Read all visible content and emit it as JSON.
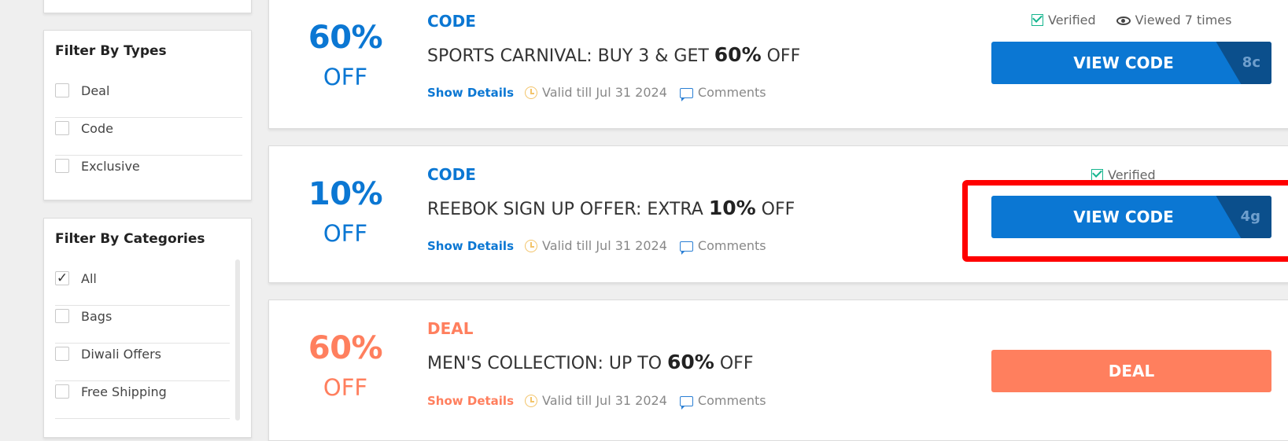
{
  "sidebar": {
    "types_title": "Filter By Types",
    "types": [
      {
        "label": "Deal",
        "checked": false
      },
      {
        "label": "Code",
        "checked": false
      },
      {
        "label": "Exclusive",
        "checked": false
      }
    ],
    "categories_title": "Filter By Categories",
    "categories": [
      {
        "label": "All",
        "checked": true,
        "check_glyph": "✓"
      },
      {
        "label": "Bags",
        "checked": false
      },
      {
        "label": "Diwali Offers",
        "checked": false
      },
      {
        "label": "Free Shipping",
        "checked": false
      }
    ]
  },
  "offers": [
    {
      "percent": "60%",
      "off": "OFF",
      "type": "CODE",
      "title_pre": "SPORTS CARNIVAL: BUY 3 & GET ",
      "title_bold": "60%",
      "title_post": " OFF",
      "show_details": "Show Details",
      "valid": "Valid till Jul 31 2024",
      "comments": "Comments",
      "verified": "Verified",
      "viewed": "Viewed 7 times",
      "button": "VIEW CODE",
      "code_peek": "8c"
    },
    {
      "percent": "10%",
      "off": "OFF",
      "type": "CODE",
      "title_pre": "REEBOK SIGN UP OFFER: EXTRA ",
      "title_bold": "10%",
      "title_post": " OFF",
      "show_details": "Show Details",
      "valid": "Valid till Jul 31 2024",
      "comments": "Comments",
      "verified": "Verified",
      "button": "VIEW CODE",
      "code_peek": "4g"
    },
    {
      "percent": "60%",
      "off": "OFF",
      "type": "DEAL",
      "title_pre": "MEN'S COLLECTION: UP TO ",
      "title_bold": "60%",
      "title_post": " OFF",
      "show_details": "Show Details",
      "valid": "Valid till Jul 31 2024",
      "comments": "Comments",
      "button": "DEAL"
    }
  ],
  "colors": {
    "code": "#0b77d3",
    "deal": "#ff7f5e",
    "verified": "#15b58e",
    "highlight": "#ff0000"
  }
}
